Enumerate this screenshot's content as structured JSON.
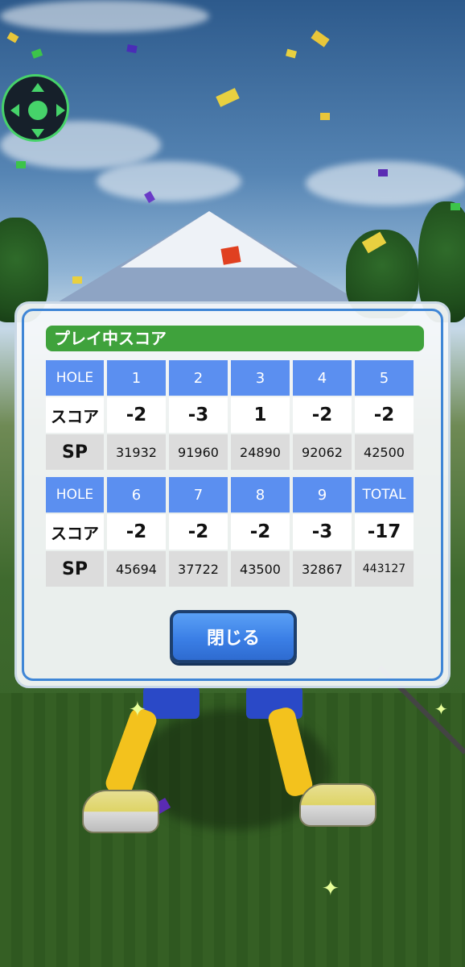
{
  "scorecard": {
    "title": "プレイ中スコア",
    "front": {
      "header": [
        "HOLE",
        "1",
        "2",
        "3",
        "4",
        "5"
      ],
      "score": [
        "スコア",
        "-2",
        "-3",
        "1",
        "-2",
        "-2"
      ],
      "sp": [
        "SP",
        "31932",
        "91960",
        "24890",
        "92062",
        "42500"
      ]
    },
    "back": {
      "header": [
        "HOLE",
        "6",
        "7",
        "8",
        "9",
        "TOTAL"
      ],
      "score": [
        "スコア",
        "-2",
        "-2",
        "-2",
        "-3",
        "-17"
      ],
      "sp": [
        "SP",
        "45694",
        "37722",
        "43500",
        "32867",
        "443127"
      ]
    },
    "close_label": "閉じる"
  },
  "colors": {
    "title_bar": "#3fa23c",
    "header_cell": "#5b8ff0",
    "modal_border": "#3f86d6",
    "dpad_accent": "#46d36a"
  },
  "icons": {
    "dpad": "camera-dpad-icon"
  }
}
